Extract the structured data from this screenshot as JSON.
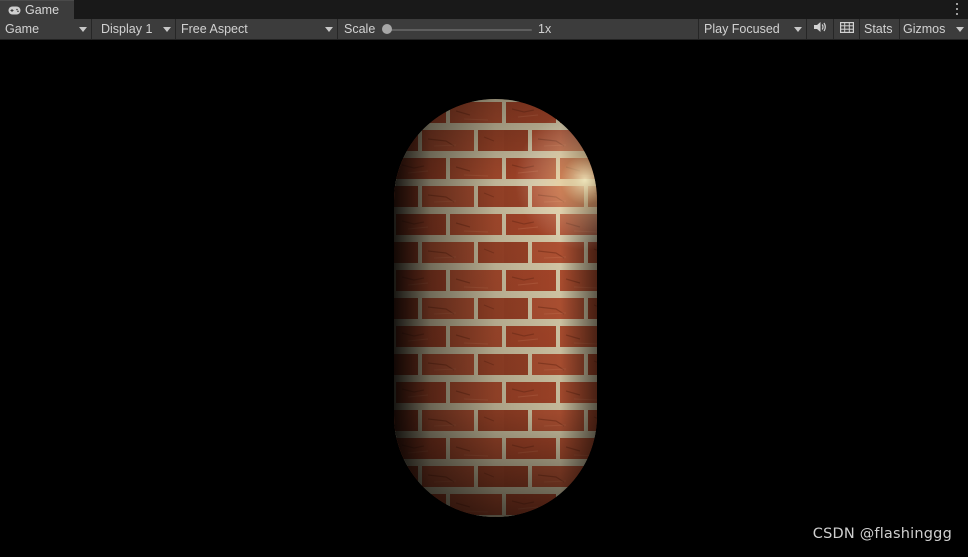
{
  "window": {
    "tab_label": "Game"
  },
  "toolbar": {
    "view_dropdown": "Game",
    "display_dropdown": "Display 1",
    "aspect_dropdown": "Free Aspect",
    "scale_label": "Scale",
    "scale_value": "1x",
    "scale_fraction": 0,
    "play_mode_dropdown": "Play Focused",
    "stats_label": "Stats",
    "gizmos_label": "Gizmos"
  },
  "icons": {
    "tab": "gamepad-icon",
    "audio": "speaker-icon",
    "stats_grid": "grid-icon",
    "menu": "kebab-menu-icon"
  },
  "viewport": {
    "object": "brick-textured-capsule",
    "watermark": "CSDN @flashinggg"
  },
  "colors": {
    "panel_bg": "#3c3c3c",
    "viewport_bg": "#000000",
    "text": "#d2d2d2",
    "brick": "#a8482a",
    "mortar": "#d9cfb0"
  }
}
